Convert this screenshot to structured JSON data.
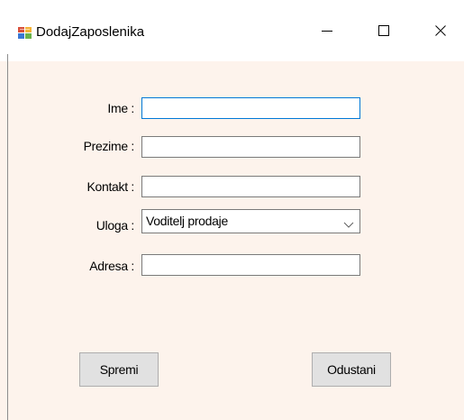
{
  "window": {
    "title": "DodajZaposlenika",
    "minimize_symbol": "—",
    "maximize_symbol": "☐",
    "close_symbol": "✕"
  },
  "form": {
    "ime": {
      "label": "Ime :",
      "value": ""
    },
    "prezime": {
      "label": "Prezime :",
      "value": ""
    },
    "kontakt": {
      "label": "Kontakt :",
      "value": ""
    },
    "uloga": {
      "label": "Uloga :",
      "value": "Voditelj prodaje"
    },
    "adresa": {
      "label": "Adresa :",
      "value": ""
    }
  },
  "buttons": {
    "save_label": "Spremi",
    "cancel_label": "Odustani"
  },
  "colors": {
    "form_background": "#fdf3ec",
    "focus_border": "#0078d7",
    "button_face": "#e1e1e1"
  },
  "icons": {
    "app": "app-form-icon",
    "minimize": "minimize-icon",
    "maximize": "maximize-icon",
    "close": "close-icon",
    "dropdown": "chevron-down-icon"
  }
}
